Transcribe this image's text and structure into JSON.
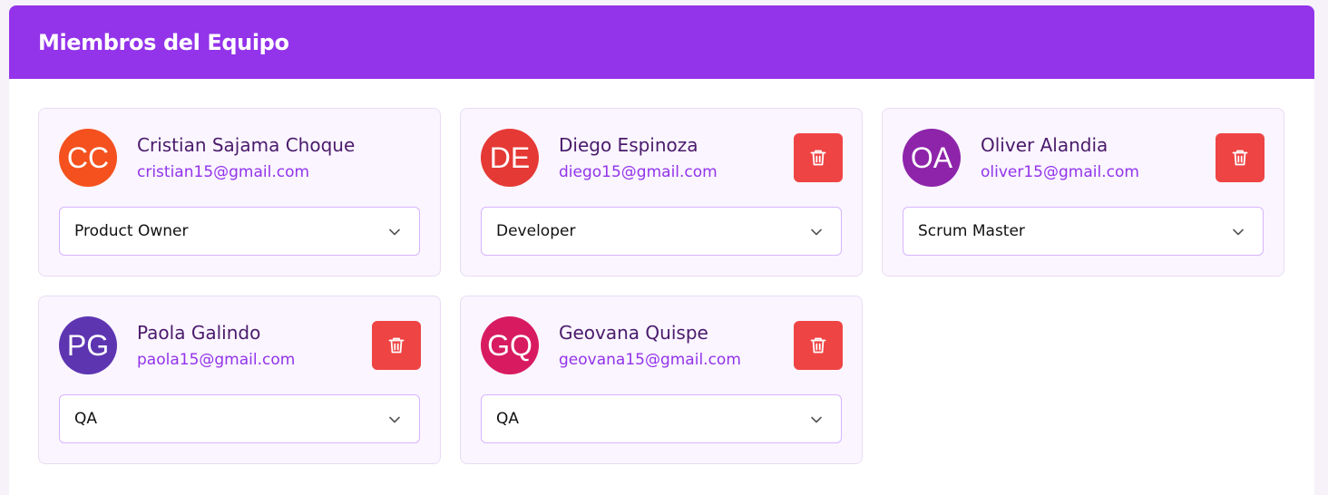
{
  "panel": {
    "title": "Miembros del Equipo",
    "header_color": "#9333ea"
  },
  "members": [
    {
      "initials": "CC",
      "name": "Cristian Sajama Choque",
      "email": "cristian15@gmail.com",
      "role": "Product Owner",
      "avatar_color": "#f4511e",
      "deletable": false
    },
    {
      "initials": "DE",
      "name": "Diego Espinoza",
      "email": "diego15@gmail.com",
      "role": "Developer",
      "avatar_color": "#e53935",
      "deletable": true
    },
    {
      "initials": "OA",
      "name": "Oliver Alandia",
      "email": "oliver15@gmail.com",
      "role": "Scrum Master",
      "avatar_color": "#8e24aa",
      "deletable": true
    },
    {
      "initials": "PG",
      "name": "Paola Galindo",
      "email": "paola15@gmail.com",
      "role": "QA",
      "avatar_color": "#5e35b1",
      "deletable": true
    },
    {
      "initials": "GQ",
      "name": "Geovana Quispe",
      "email": "geovana15@gmail.com",
      "role": "QA",
      "avatar_color": "#d81b60",
      "deletable": true
    }
  ],
  "icons": {
    "delete": "trash-icon",
    "dropdown": "chevron-down-icon"
  },
  "colors": {
    "delete_button": "#ef4444",
    "select_border": "#d8b4fe",
    "card_background": "#faf5ff"
  }
}
